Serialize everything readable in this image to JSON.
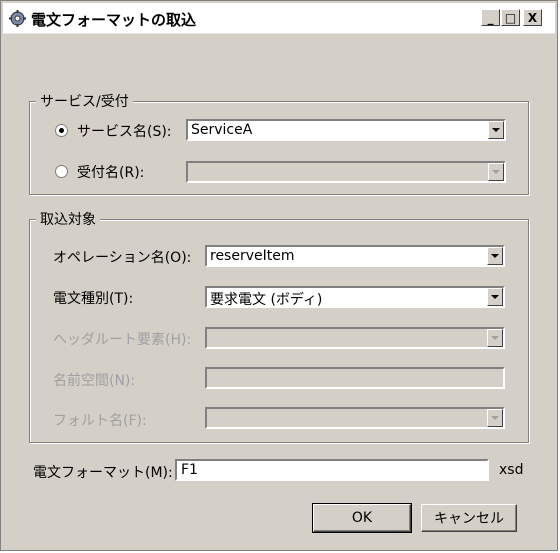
{
  "window": {
    "title": "電文フォーマットの取込",
    "minimize": "_",
    "maximize": "□",
    "close": "X"
  },
  "service_group": {
    "legend": "サービス/受付",
    "service_radio_label": "サービス名(S):",
    "service_value": "ServiceA",
    "receive_radio_label": "受付名(R):",
    "receive_value": ""
  },
  "target_group": {
    "legend": "取込対象",
    "operation_label": "オペレーション名(O):",
    "operation_value": "reserveItem",
    "message_type_label": "電文種別(T):",
    "message_type_value": "要求電文 (ボディ)",
    "header_root_label": "ヘッダルート要素(H):",
    "header_root_value": "",
    "namespace_label": "名前空間(N):",
    "namespace_value": "",
    "fault_label": "フォルト名(F):",
    "fault_value": ""
  },
  "format": {
    "label": "電文フォーマット(M):",
    "value": "F1",
    "suffix": "xsd"
  },
  "buttons": {
    "ok": "OK",
    "cancel": "キャンセル"
  }
}
